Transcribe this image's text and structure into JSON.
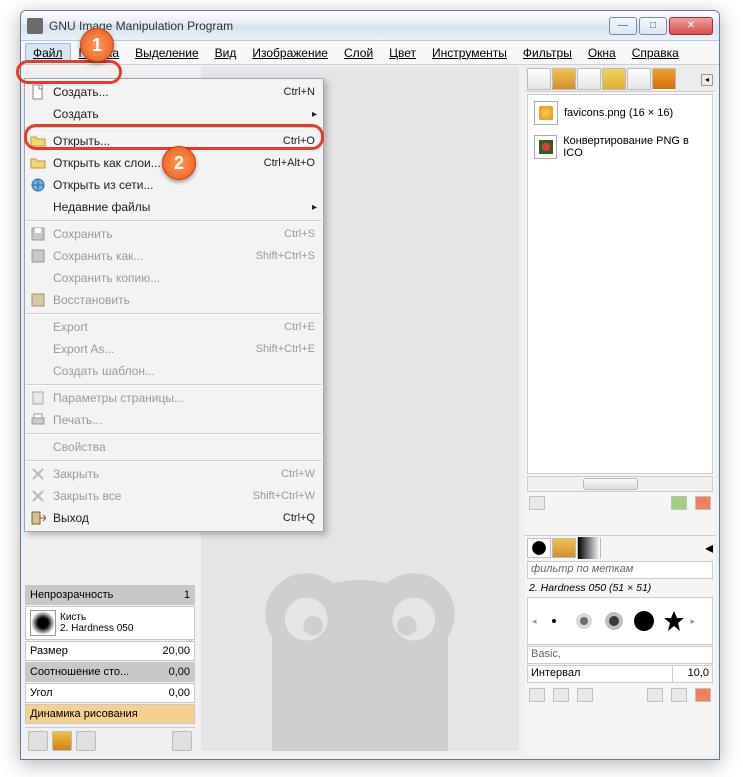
{
  "window": {
    "title": "GNU Image Manipulation Program"
  },
  "menubar": [
    "Файл",
    "Правка",
    "Выделение",
    "Вид",
    "Изображение",
    "Слой",
    "Цвет",
    "Инструменты",
    "Фильтры",
    "Окна",
    "Справка"
  ],
  "file_menu": {
    "items": [
      {
        "label": "Создать...",
        "shortcut": "Ctrl+N",
        "icon": "new"
      },
      {
        "label": "Создать",
        "submenu": true
      },
      {
        "sep": true
      },
      {
        "label": "Открыть...",
        "shortcut": "Ctrl+O",
        "icon": "folder",
        "highlight": true
      },
      {
        "label": "Открыть как слои...",
        "shortcut": "Ctrl+Alt+O",
        "icon": "folder"
      },
      {
        "label": "Открыть из сети...",
        "icon": "globe"
      },
      {
        "label": "Недавние файлы",
        "submenu": true
      },
      {
        "sep": true
      },
      {
        "label": "Сохранить",
        "shortcut": "Ctrl+S",
        "icon": "save",
        "disabled": true
      },
      {
        "label": "Сохранить как...",
        "shortcut": "Shift+Ctrl+S",
        "icon": "save",
        "disabled": true
      },
      {
        "label": "Сохранить копию...",
        "disabled": true
      },
      {
        "label": "Восстановить",
        "icon": "revert",
        "disabled": true
      },
      {
        "sep": true
      },
      {
        "label": "Export",
        "shortcut": "Ctrl+E",
        "disabled": true
      },
      {
        "label": "Export As...",
        "shortcut": "Shift+Ctrl+E",
        "disabled": true
      },
      {
        "label": "Создать шаблон...",
        "disabled": true
      },
      {
        "sep": true
      },
      {
        "label": "Параметры страницы...",
        "icon": "page",
        "disabled": true
      },
      {
        "label": "Печать...",
        "icon": "print",
        "disabled": true
      },
      {
        "sep": true
      },
      {
        "label": "Свойства",
        "disabled": true
      },
      {
        "sep": true
      },
      {
        "label": "Закрыть",
        "shortcut": "Ctrl+W",
        "icon": "close",
        "disabled": true
      },
      {
        "label": "Закрыть все",
        "shortcut": "Shift+Ctrl+W",
        "icon": "close",
        "disabled": true
      },
      {
        "label": "Выход",
        "shortcut": "Ctrl+Q",
        "icon": "exit"
      }
    ]
  },
  "left_dock": {
    "opacity_label": "Непрозрачность",
    "opacity_value": "1",
    "brush_label": "Кисть",
    "brush_value": "2. Hardness 050",
    "size_label": "Размер",
    "size_value": "20,00",
    "ratio_label": "Соотношение сто...",
    "ratio_value": "0,00",
    "angle_label": "Угол",
    "angle_value": "0,00",
    "dynamics_label": "Динамика рисования"
  },
  "right_dock": {
    "layers": [
      {
        "name": "favicons.png (16 × 16)",
        "thumb": "orange"
      },
      {
        "name": "Конвертирование PNG в ICO",
        "thumb": "flower"
      }
    ]
  },
  "brush_dock": {
    "filter_placeholder": "фильтр по меткам",
    "brush_name": "2. Hardness 050 (51 × 51)",
    "basic_label": "Basic,",
    "interval_label": "Интервал",
    "interval_value": "10,0"
  },
  "badges": {
    "one": "1",
    "two": "2"
  }
}
